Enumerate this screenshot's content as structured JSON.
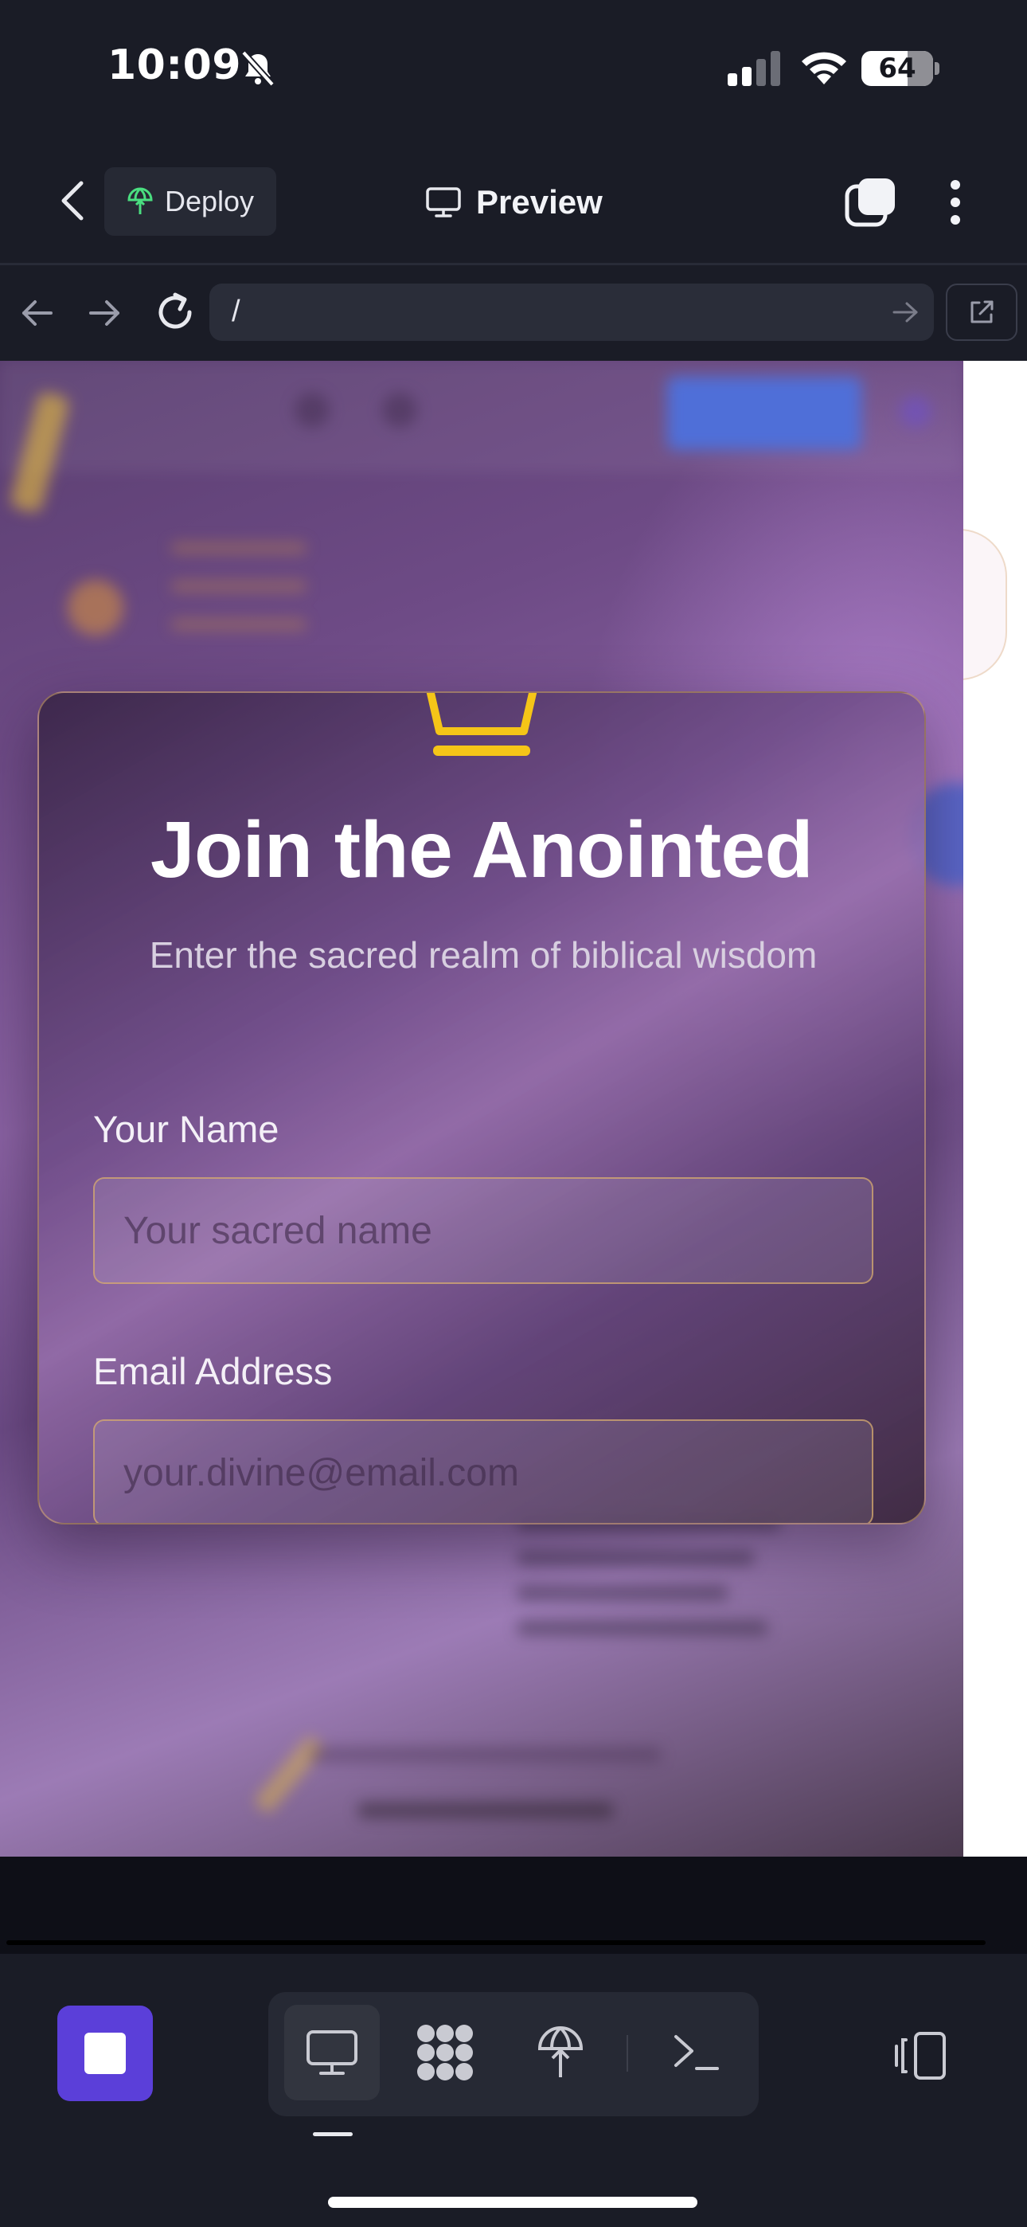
{
  "status_bar": {
    "time": "10:09",
    "battery_percent": "64",
    "icons": [
      "bell-off-icon",
      "signal-icon",
      "wifi-icon",
      "battery-icon"
    ]
  },
  "app_bar": {
    "deploy_label": "Deploy",
    "preview_label": "Preview",
    "icons": [
      "back-arrow-icon",
      "deploy-icon",
      "monitor-icon",
      "tabs-icon",
      "more-vertical-icon"
    ]
  },
  "browser": {
    "url": "/",
    "icons": [
      "arrow-left-icon",
      "arrow-right-icon",
      "reload-icon",
      "go-arrow-icon",
      "external-link-icon"
    ]
  },
  "modal": {
    "title": "Join the Anointed",
    "subtitle": "Enter the sacred realm of biblical wisdom",
    "name_label": "Your Name",
    "name_placeholder": "Your sacred name",
    "name_value": "",
    "email_label": "Email Address",
    "email_placeholder": "your.divine@email.com",
    "email_value": ""
  },
  "toolbar": {
    "tools": [
      "stop-icon",
      "monitor-icon",
      "grid-icon",
      "deploy-icon",
      "terminal-icon",
      "layout-toggle-icon"
    ],
    "active_tool": "monitor-icon"
  },
  "colors": {
    "accent_purple": "#5b3fd9",
    "gold": "#f5c518",
    "deploy_green": "#4ade80"
  }
}
